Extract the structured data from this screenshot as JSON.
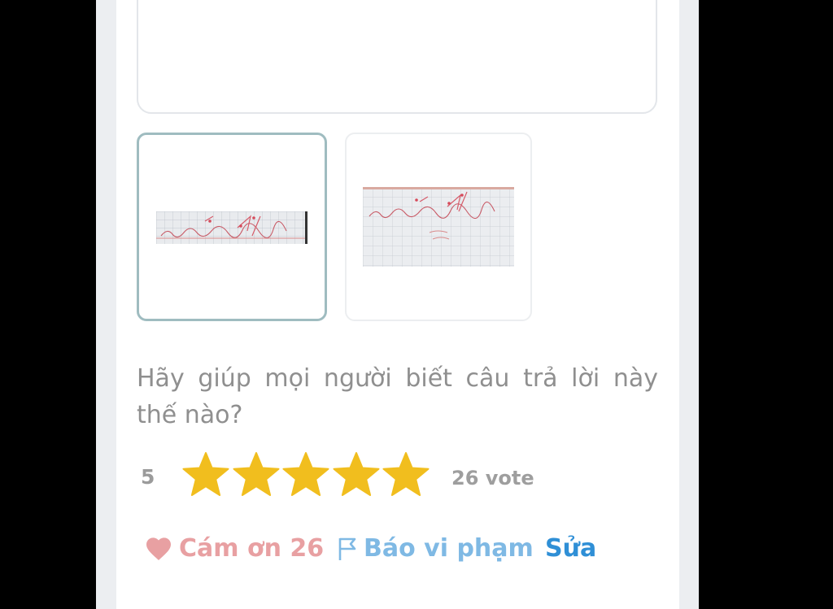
{
  "rating": {
    "prompt": "Hãy giúp mọi người biết câu trả lời này thế nào?",
    "average": "5",
    "stars": 5,
    "max_stars": 5,
    "vote_text": "26 vote",
    "star_color": "#f1be1e"
  },
  "thumbnails": [
    {
      "selected": true
    },
    {
      "selected": false
    }
  ],
  "actions": {
    "thanks_label": "Cám ơn 26",
    "report_label": "Báo vi phạm",
    "edit_label": "Sửa"
  },
  "colors": {
    "thanks": "#e8a0a2",
    "report": "#7fb9e4",
    "edit": "#2f8fd6"
  }
}
